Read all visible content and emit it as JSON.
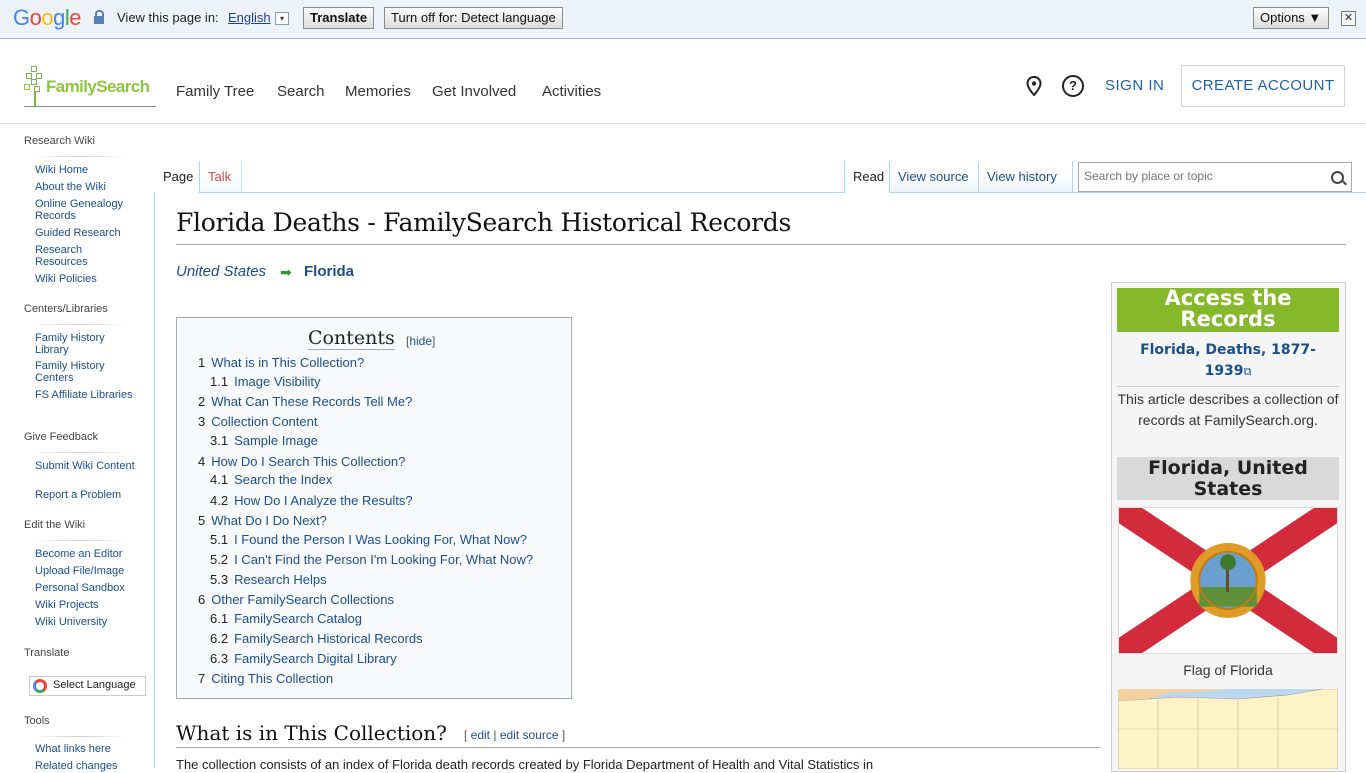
{
  "translate_bar": {
    "logo_text": "Google",
    "view_text": "View this page in:",
    "language": "English",
    "dropdown_glyph": "▾",
    "translate_button": "Translate",
    "turn_off_button": "Turn off for: Detect language",
    "options_button": "Options ▼",
    "close_glyph": "✕"
  },
  "header": {
    "logo_text": "FamilySearch",
    "nav": [
      "Family Tree",
      "Search",
      "Memories",
      "Get Involved",
      "Activities"
    ],
    "help_glyph": "?",
    "sign_in": "SIGN IN",
    "create_account": "CREATE ACCOUNT"
  },
  "sidebar": {
    "sections": [
      {
        "title": "Research Wiki",
        "links": [
          "Wiki Home",
          "About the Wiki",
          "Online Genealogy Records",
          "Guided Research",
          "Research Resources",
          "Wiki Policies"
        ]
      },
      {
        "title": "Centers/Libraries",
        "links": [
          "Family History Library",
          "Family History Centers",
          "FS Affiliate Libraries"
        ]
      },
      {
        "title": "Give Feedback",
        "links": [
          "Submit Wiki Content",
          "Report a Problem"
        ]
      },
      {
        "title": "Edit the Wiki",
        "links": [
          "Become an Editor",
          "Upload File/Image",
          "Personal Sandbox",
          "Wiki Projects",
          "Wiki University"
        ]
      },
      {
        "title": "Translate",
        "links": []
      },
      {
        "title": "Tools",
        "links": [
          "What links here",
          "Related changes"
        ]
      }
    ],
    "select_language": "Select Language"
  },
  "tabs": {
    "page": "Page",
    "talk": "Talk",
    "read": "Read",
    "view_source": "View source",
    "view_history": "View history"
  },
  "search": {
    "placeholder": "Search by place or topic"
  },
  "article": {
    "title": "Florida Deaths - FamilySearch Historical Records",
    "breadcrumb": {
      "parent": "United States",
      "arrow": "➡",
      "current": "Florida"
    },
    "toc": {
      "title": "Contents",
      "hide_label": "hide",
      "items": [
        {
          "num": "1",
          "text": "What is in This Collection?",
          "level": 1
        },
        {
          "num": "1.1",
          "text": "Image Visibility",
          "level": 2
        },
        {
          "num": "2",
          "text": "What Can These Records Tell Me?",
          "level": 1
        },
        {
          "num": "3",
          "text": "Collection Content",
          "level": 1
        },
        {
          "num": "3.1",
          "text": "Sample Image",
          "level": 2
        },
        {
          "num": "4",
          "text": "How Do I Search This Collection?",
          "level": 1
        },
        {
          "num": "4.1",
          "text": "Search the Index",
          "level": 2
        },
        {
          "num": "4.2",
          "text": "How Do I Analyze the Results?",
          "level": 2
        },
        {
          "num": "5",
          "text": "What Do I Do Next?",
          "level": 1
        },
        {
          "num": "5.1",
          "text": "I Found the Person I Was Looking For, What Now?",
          "level": 2
        },
        {
          "num": "5.2",
          "text": "I Can't Find the Person I'm Looking For, What Now?",
          "level": 2
        },
        {
          "num": "5.3",
          "text": "Research Helps",
          "level": 2
        },
        {
          "num": "6",
          "text": "Other FamilySearch Collections",
          "level": 1
        },
        {
          "num": "6.1",
          "text": "FamilySearch Catalog",
          "level": 2
        },
        {
          "num": "6.2",
          "text": "FamilySearch Historical Records",
          "level": 2
        },
        {
          "num": "6.3",
          "text": "FamilySearch Digital Library",
          "level": 2
        },
        {
          "num": "7",
          "text": "Citing This Collection",
          "level": 1
        }
      ]
    },
    "section1": {
      "heading": "What is in This Collection?",
      "edit": "edit",
      "edit_source": "edit source",
      "body": "The collection consists of an index of Florida death records created by Florida Department of Health and Vital Statistics in"
    }
  },
  "infobox": {
    "access_heading": "Access the Records",
    "record_link": "Florida, Deaths, 1877-1939",
    "external_glyph": "⧉",
    "description": "This article describes a collection of records at FamilySearch.org.",
    "state_heading": "Florida, United States",
    "flag_caption": "Flag of Florida",
    "colors": {
      "access_green": "#85b82a",
      "flag_red": "#d22c3c",
      "seal_gold": "#e09a26"
    }
  }
}
